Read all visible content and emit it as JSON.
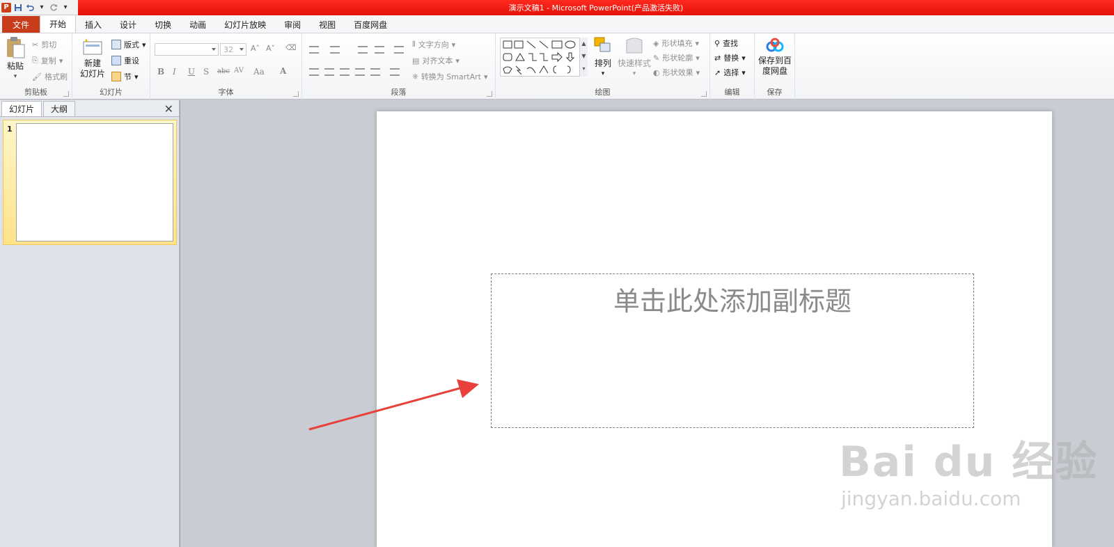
{
  "window": {
    "title": "演示文稿1 - Microsoft PowerPoint(产品激活失败)"
  },
  "qat": {
    "app_icon": "P"
  },
  "tabs": [
    {
      "label": "文件"
    },
    {
      "label": "开始"
    },
    {
      "label": "插入"
    },
    {
      "label": "设计"
    },
    {
      "label": "切换"
    },
    {
      "label": "动画"
    },
    {
      "label": "幻灯片放映"
    },
    {
      "label": "审阅"
    },
    {
      "label": "视图"
    },
    {
      "label": "百度网盘"
    }
  ],
  "ribbon": {
    "clipboard": {
      "paste": "粘贴",
      "cut": "剪切",
      "copy": "复制",
      "format_painter": "格式刷",
      "label": "剪贴板"
    },
    "slides": {
      "new_slide_1": "新建",
      "new_slide_2": "幻灯片",
      "layout": "版式",
      "reset": "重设",
      "section": "节",
      "label": "幻灯片"
    },
    "font": {
      "font_size": "32",
      "label": "字体",
      "bold": "B",
      "italic": "I",
      "underline": "U",
      "shadow": "S",
      "strike": "abc",
      "spacing": "AV",
      "case": "Aa",
      "color": "A"
    },
    "paragraph": {
      "text_direction": "文字方向",
      "align_text": "对齐文本",
      "smartart": "转换为 SmartArt",
      "label": "段落"
    },
    "drawing": {
      "arrange": "排列",
      "quick_styles": "快速样式",
      "shape_fill": "形状填充",
      "shape_outline": "形状轮廓",
      "shape_effects": "形状效果",
      "label": "绘图"
    },
    "editing": {
      "find": "查找",
      "replace": "替换",
      "select": "选择",
      "label": "编辑"
    },
    "save": {
      "line1": "保存到百",
      "line2": "度网盘",
      "label": "保存"
    }
  },
  "left_panel": {
    "tab_slides": "幻灯片",
    "tab_outline": "大纲",
    "slide_number": "1"
  },
  "slide": {
    "subtitle_placeholder": "单击此处添加副标题"
  },
  "watermark": {
    "line1": "Bai du 经验",
    "line2": "jingyan.baidu.com"
  },
  "colors": {
    "title_bar": "#e3120b",
    "file_tab": "#c83b1b",
    "arrow": "#e8403a"
  }
}
